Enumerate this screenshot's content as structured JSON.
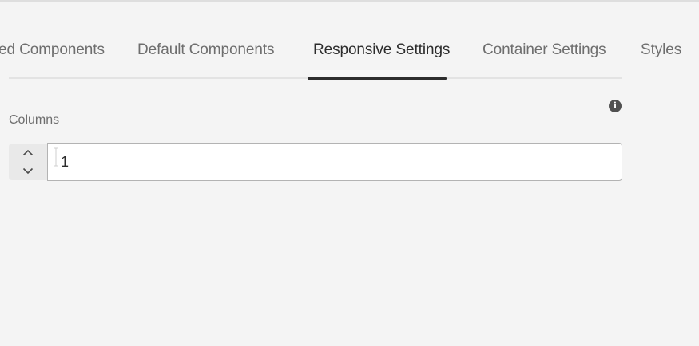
{
  "tabs": [
    {
      "label": "ed Components",
      "selected": false
    },
    {
      "label": "Default Components",
      "selected": false
    },
    {
      "label": "Responsive Settings",
      "selected": true
    },
    {
      "label": "Container Settings",
      "selected": false
    },
    {
      "label": "Styles",
      "selected": false
    }
  ],
  "columns_field": {
    "label": "Columns",
    "value": "1",
    "info_icon": "info-icon",
    "stepper_up_icon": "chevron-up-icon",
    "stepper_down_icon": "chevron-down-icon"
  },
  "colors": {
    "background": "#f4f4f4",
    "selected_tab_text": "#2c2c2c",
    "tab_text": "#6e6e6e",
    "input_border": "#b3b3b3"
  }
}
